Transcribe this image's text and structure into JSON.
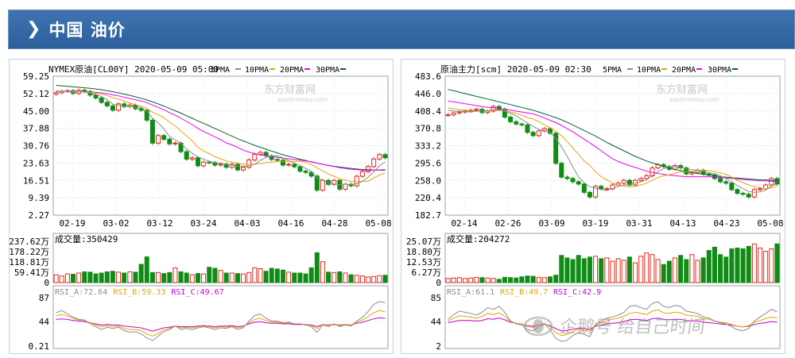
{
  "header": {
    "title": "中国  油价"
  },
  "colors": {
    "up": "#e0281a",
    "down": "#0f8c14",
    "ma5": "#8c8c8c",
    "ma10": "#e6a400",
    "ma20": "#ee00ee",
    "ma30": "#006633",
    "rsi_a": "#8c8c8c",
    "rsi_b": "#e6a400",
    "rsi_c": "#cc00cc"
  },
  "watermark": {
    "text": "企鹅号 给自己时间"
  },
  "chart_data": [
    {
      "type": "candlestick",
      "title": "NYMEX原油[CL00Y] 2020-05-09 05:00",
      "brand": "东方财富网",
      "brand_sub": "eastmoney.com",
      "legend": [
        {
          "label": "5PMA",
          "color": "#8c8c8c"
        },
        {
          "label": "10PMA",
          "color": "#e6a400"
        },
        {
          "label": "20PMA",
          "color": "#ee00ee"
        },
        {
          "label": "30PMA",
          "color": "#006633"
        }
      ],
      "price_ticks": [
        "59.25",
        "52.12",
        "45.00",
        "37.88",
        "30.76",
        "23.63",
        "16.51",
        "9.39",
        "2.27"
      ],
      "ylim": [
        2.27,
        59.25
      ],
      "dates": [
        "02-19",
        "03-02",
        "03-12",
        "03-24",
        "04-03",
        "04-16",
        "04-28",
        "05-08"
      ],
      "close": [
        52.5,
        53.1,
        53.3,
        52.2,
        53.5,
        53.0,
        51.5,
        50.3,
        48.5,
        47.1,
        45.3,
        47.9,
        46.8,
        47.4,
        45.9,
        45.3,
        41.2,
        31.8,
        34.9,
        33.4,
        31.5,
        31.8,
        28.3,
        25.2,
        25.8,
        22.5,
        24.0,
        23.8,
        22.8,
        23.2,
        21.9,
        23.1,
        20.8,
        21.9,
        24.9,
        27.2,
        28.0,
        26.6,
        25.1,
        24.8,
        22.8,
        23.1,
        22.1,
        20.3,
        19.8,
        18.3,
        12.5,
        16.5,
        14.9,
        16.5,
        12.9,
        14.9,
        14.3,
        18.2,
        20.1,
        22.2,
        25.3,
        27.1,
        25.8
      ],
      "ma5": [
        53.0,
        53.2,
        53.0,
        52.7,
        52.9,
        52.8,
        52.3,
        51.7,
        50.9,
        49.6,
        47.8,
        47.4,
        47.1,
        46.9,
        46.4,
        46.5,
        44.9,
        42.0,
        40.1,
        37.7,
        34.5,
        33.2,
        31.6,
        29.5,
        27.7,
        26.1,
        25.3,
        24.3,
        23.8,
        23.6,
        23.0,
        22.8,
        22.3,
        22.2,
        22.6,
        23.1,
        24.7,
        25.9,
        26.5,
        26.6,
        25.8,
        24.6,
        23.6,
        22.6,
        21.5,
        20.2,
        17.6,
        16.6,
        15.5,
        15.1,
        14.7,
        15.0,
        14.9,
        15.1,
        16.1,
        17.9,
        20.0,
        22.5,
        24.1
      ],
      "ma10": [
        53.0,
        53.1,
        53.0,
        52.9,
        52.9,
        52.8,
        52.6,
        52.3,
        51.9,
        51.3,
        50.4,
        49.9,
        49.0,
        48.3,
        47.5,
        47.0,
        46.0,
        44.5,
        43.5,
        42.2,
        40.4,
        38.9,
        36.7,
        34.8,
        32.7,
        30.1,
        28.6,
        27.5,
        26.2,
        25.4,
        24.5,
        24.0,
        23.5,
        23.1,
        23.1,
        23.1,
        23.4,
        23.8,
        24.0,
        24.3,
        24.3,
        24.4,
        24.3,
        24.3,
        24.0,
        23.0,
        21.7,
        20.4,
        19.1,
        18.2,
        17.1,
        16.7,
        16.0,
        15.9,
        16.1,
        16.2,
        17.5,
        18.7,
        19.6
      ],
      "ma20": [
        53.2,
        53.1,
        53.1,
        53.0,
        53.0,
        52.9,
        52.8,
        52.6,
        52.4,
        52.1,
        51.6,
        51.2,
        50.6,
        50.1,
        49.6,
        49.1,
        48.4,
        47.4,
        46.5,
        45.5,
        44.3,
        43.3,
        42.0,
        40.7,
        39.4,
        37.8,
        36.6,
        35.5,
        34.3,
        33.2,
        31.9,
        31.1,
        30.0,
        28.9,
        28.1,
        27.5,
        27.0,
        26.6,
        26.2,
        26.0,
        25.6,
        25.4,
        25.1,
        24.8,
        24.5,
        24.2,
        23.6,
        23.1,
        22.6,
        22.2,
        21.7,
        21.4,
        21.1,
        20.9,
        20.7,
        20.6,
        20.7,
        20.8,
        21.0
      ],
      "ma30": [
        55.5,
        55.3,
        55.1,
        54.9,
        54.7,
        54.5,
        54.3,
        54.0,
        53.7,
        53.3,
        52.9,
        52.4,
        51.9,
        51.4,
        50.8,
        50.2,
        49.5,
        48.7,
        47.9,
        47.0,
        46.0,
        45.1,
        44.1,
        43.0,
        42.0,
        40.9,
        39.9,
        38.9,
        37.8,
        36.8,
        35.7,
        34.7,
        33.6,
        32.7,
        31.8,
        30.9,
        30.1,
        29.3,
        28.5,
        27.8,
        27.0,
        26.4,
        25.8,
        25.2,
        24.7,
        24.1,
        23.6,
        23.1,
        22.7,
        22.3,
        22.0,
        21.7,
        21.4,
        21.2,
        21.0,
        20.9,
        20.8,
        20.7,
        20.7
      ],
      "volume_label": "成交量:350429",
      "volume_ticks": [
        "237.62万",
        "178.22万",
        "118.81万",
        "59.41万",
        "0"
      ],
      "volume_max": 237.62,
      "volume": [
        45,
        38,
        50,
        48,
        55,
        62,
        60,
        50,
        55,
        62,
        65,
        60,
        55,
        62,
        60,
        105,
        148,
        58,
        58,
        52,
        58,
        85,
        62,
        55,
        45,
        52,
        50,
        88,
        82,
        70,
        55,
        55,
        52,
        50,
        58,
        85,
        80,
        65,
        82,
        78,
        72,
        60,
        55,
        55,
        50,
        85,
        172,
        120,
        60,
        58,
        62,
        55,
        45,
        42,
        38,
        32,
        35,
        40,
        42
      ],
      "rsi_label": "RSI_A:72.64 RSI_B:59.33 RSI_C:49.67",
      "rsi_legend": [
        {
          "label": "RSI_A:72.64",
          "color": "#8c8c8c"
        },
        {
          "label": "RSI_B:59.33",
          "color": "#e6a400"
        },
        {
          "label": "RSI_C:49.67",
          "color": "#cc00cc"
        }
      ],
      "rsi_ticks": [
        "87",
        "44",
        "0.21"
      ],
      "rsi_ylim": [
        0.21,
        87
      ],
      "rsi_a": [
        60,
        64,
        58,
        52,
        48,
        47,
        40,
        35,
        30,
        34,
        32,
        34,
        28,
        25,
        26,
        22,
        15,
        10,
        18,
        26,
        30,
        36,
        30,
        32,
        30,
        33,
        35,
        33,
        30,
        33,
        32,
        35,
        30,
        33,
        45,
        55,
        58,
        50,
        45,
        45,
        42,
        43,
        40,
        40,
        38,
        35,
        25,
        38,
        35,
        40,
        35,
        38,
        36,
        45,
        52,
        62,
        75,
        80,
        78
      ],
      "rsi_b": [
        55,
        57,
        54,
        50,
        47,
        46,
        42,
        38,
        35,
        37,
        35,
        36,
        32,
        30,
        30,
        28,
        22,
        18,
        23,
        29,
        32,
        36,
        33,
        34,
        33,
        35,
        36,
        35,
        33,
        35,
        34,
        36,
        33,
        35,
        42,
        48,
        50,
        46,
        43,
        43,
        41,
        42,
        40,
        40,
        39,
        37,
        32,
        39,
        37,
        40,
        37,
        39,
        38,
        43,
        47,
        53,
        60,
        64,
        62
      ],
      "rsi_c": [
        48,
        49,
        48,
        46,
        45,
        44,
        42,
        40,
        38,
        39,
        38,
        38,
        36,
        35,
        34,
        33,
        30,
        27,
        30,
        33,
        34,
        36,
        35,
        35,
        35,
        36,
        37,
        36,
        35,
        36,
        36,
        37,
        35,
        36,
        40,
        43,
        44,
        42,
        41,
        41,
        40,
        40,
        39,
        39,
        39,
        38,
        35,
        39,
        38,
        39,
        38,
        39,
        38,
        41,
        43,
        46,
        49,
        51,
        50
      ]
    },
    {
      "type": "candlestick",
      "title": "原油主力[scm] 2020-05-09 02:30",
      "brand": "东方财富网",
      "brand_sub": "eastmoney.com",
      "legend": [
        {
          "label": "5PMA",
          "color": "#8c8c8c"
        },
        {
          "label": "10PMA",
          "color": "#e6a400"
        },
        {
          "label": "20PMA",
          "color": "#ee00ee"
        },
        {
          "label": "30PMA",
          "color": "#006633"
        }
      ],
      "price_ticks": [
        "483.6",
        "446.0",
        "408.4",
        "370.8",
        "333.2",
        "295.6",
        "258.0",
        "220.4",
        "182.7"
      ],
      "ylim": [
        182.7,
        483.6
      ],
      "dates": [
        "02-14",
        "02-26",
        "03-09",
        "03-19",
        "03-31",
        "04-13",
        "04-23",
        "05-08"
      ],
      "close": [
        400,
        404,
        406,
        408,
        410,
        412,
        405,
        408,
        418,
        412,
        395,
        385,
        380,
        378,
        362,
        355,
        365,
        370,
        360,
        295,
        265,
        262,
        255,
        250,
        232,
        222,
        245,
        240,
        240,
        248,
        252,
        258,
        248,
        258,
        262,
        268,
        285,
        292,
        288,
        282,
        290,
        285,
        272,
        275,
        280,
        272,
        270,
        262,
        255,
        252,
        238,
        230,
        228,
        222,
        238,
        240,
        248,
        262,
        250
      ],
      "ma5": [
        410,
        408,
        407,
        407,
        406,
        408,
        408,
        409,
        411,
        411,
        408,
        403,
        398,
        390,
        382,
        375,
        368,
        366,
        362,
        349,
        331,
        310,
        287,
        265,
        253,
        244,
        241,
        238,
        236,
        240,
        245,
        248,
        249,
        252,
        255,
        259,
        268,
        277,
        283,
        287,
        287,
        287,
        283,
        281,
        280,
        277,
        274,
        272,
        268,
        262,
        255,
        247,
        240,
        234,
        232,
        233,
        237,
        246,
        250
      ],
      "ma10": [
        415,
        413,
        411,
        410,
        409,
        408,
        408,
        408,
        409,
        409,
        409,
        406,
        403,
        399,
        394,
        391,
        385,
        378,
        372,
        364,
        355,
        342,
        328,
        314,
        300,
        290,
        276,
        266,
        259,
        252,
        248,
        246,
        244,
        245,
        248,
        252,
        258,
        264,
        268,
        270,
        273,
        277,
        277,
        278,
        279,
        280,
        279,
        277,
        274,
        271,
        265,
        258,
        253,
        248,
        244,
        242,
        240,
        242,
        245
      ],
      "ma20": [
        430,
        428,
        426,
        424,
        422,
        420,
        418,
        416,
        415,
        414,
        412,
        410,
        408,
        406,
        404,
        402,
        398,
        393,
        388,
        383,
        377,
        370,
        363,
        355,
        347,
        339,
        331,
        322,
        313,
        305,
        299,
        294,
        290,
        286,
        282,
        278,
        275,
        273,
        271,
        269,
        268,
        267,
        266,
        266,
        266,
        266,
        266,
        265,
        264,
        263,
        262,
        261,
        260,
        259,
        258,
        257,
        257,
        256,
        256
      ],
      "ma30": [
        455,
        452,
        449,
        446,
        443,
        440,
        437,
        434,
        431,
        428,
        425,
        422,
        419,
        416,
        413,
        410,
        406,
        402,
        398,
        394,
        389,
        384,
        378,
        372,
        366,
        360,
        354,
        347,
        340,
        334,
        328,
        322,
        316,
        310,
        305,
        300,
        296,
        292,
        288,
        285,
        282,
        279,
        277,
        275,
        273,
        271,
        269,
        268,
        266,
        265,
        264,
        263,
        262,
        261,
        260,
        259,
        259,
        258,
        258
      ],
      "volume_label": "成交量:204272",
      "volume_ticks": [
        "25.07万",
        "18.80万",
        "12.53万",
        "6.27万",
        "0"
      ],
      "volume_max": 25.07,
      "volume": [
        2.5,
        2.8,
        3.0,
        2.5,
        2.8,
        3.2,
        3.0,
        2.8,
        2.5,
        2.0,
        3.2,
        3.0,
        2.8,
        3.5,
        4.0,
        3.8,
        3.2,
        3.0,
        3.5,
        4.5,
        16.5,
        15.0,
        14.0,
        16.5,
        14.5,
        15.5,
        16.0,
        14.5,
        15.0,
        13.0,
        14.5,
        13.5,
        15.5,
        12.0,
        16.0,
        18.0,
        17.0,
        14.0,
        11.0,
        13.0,
        15.0,
        16.5,
        14.0,
        17.0,
        13.5,
        15.0,
        19.5,
        21.5,
        17.0,
        15.5,
        20.5,
        21.0,
        20.5,
        22.0,
        23.5,
        21.0,
        19.0,
        20.5,
        23.5
      ],
      "rsi_label": "RSI_A:61.1 RSI_B:49.7 RSI_C:42.9",
      "rsi_legend": [
        {
          "label": "RSI_A:61.1",
          "color": "#8c8c8c"
        },
        {
          "label": "RSI_B:49.7",
          "color": "#e6a400"
        },
        {
          "label": "RSI_C:42.9",
          "color": "#cc00cc"
        }
      ],
      "rsi_ticks": [
        "85",
        "44",
        "2"
      ],
      "rsi_ylim": [
        2,
        85
      ],
      "rsi_a": [
        48,
        56,
        62,
        60,
        58,
        55,
        60,
        68,
        65,
        70,
        60,
        45,
        40,
        38,
        30,
        28,
        35,
        40,
        30,
        15,
        10,
        12,
        20,
        25,
        22,
        18,
        40,
        45,
        50,
        52,
        55,
        60,
        70,
        72,
        68,
        65,
        75,
        78,
        70,
        68,
        72,
        70,
        62,
        60,
        58,
        52,
        50,
        45,
        42,
        40,
        35,
        30,
        28,
        32,
        45,
        52,
        58,
        65,
        61
      ],
      "rsi_b": [
        45,
        50,
        54,
        53,
        52,
        50,
        53,
        58,
        56,
        59,
        53,
        44,
        41,
        40,
        35,
        34,
        38,
        41,
        35,
        25,
        20,
        22,
        27,
        31,
        29,
        27,
        38,
        42,
        46,
        48,
        50,
        53,
        58,
        60,
        58,
        56,
        62,
        64,
        59,
        58,
        60,
        59,
        55,
        54,
        53,
        49,
        48,
        45,
        43,
        42,
        39,
        36,
        35,
        37,
        43,
        46,
        49,
        52,
        49.7
      ],
      "rsi_c": [
        42,
        44,
        46,
        46,
        46,
        45,
        46,
        49,
        48,
        50,
        47,
        43,
        41,
        40,
        37,
        36,
        38,
        40,
        37,
        32,
        28,
        29,
        31,
        33,
        32,
        31,
        36,
        38,
        40,
        41,
        42,
        44,
        47,
        48,
        47,
        46,
        49,
        50,
        48,
        47,
        48,
        48,
        46,
        45,
        45,
        43,
        42,
        41,
        40,
        39,
        38,
        36,
        35,
        36,
        39,
        41,
        42,
        44,
        42.9
      ]
    }
  ]
}
